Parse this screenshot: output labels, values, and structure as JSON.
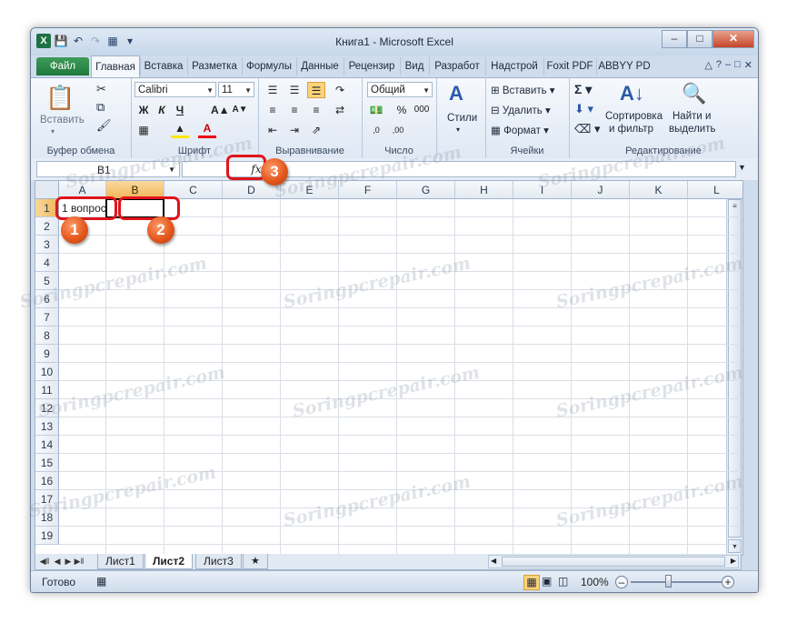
{
  "window": {
    "title": "Книга1 - Microsoft Excel"
  },
  "tabs": [
    "Файл",
    "Главная",
    "Вставка",
    "Разметка",
    "Формулы",
    "Данные",
    "Рецензир",
    "Вид",
    "Разработ",
    "Надстрой",
    "Foxit PDF",
    "ABBYY PD"
  ],
  "ribbon": {
    "clipboard": {
      "paste": "Вставить",
      "label": "Буфер обмена"
    },
    "font": {
      "name": "Calibri",
      "size": "11",
      "bold": "Ж",
      "italic": "К",
      "underline": "Ч",
      "label": "Шрифт"
    },
    "align": {
      "label": "Выравнивание"
    },
    "number": {
      "format": "Общий",
      "label": "Число"
    },
    "styles": {
      "label": "Стили"
    },
    "cells": {
      "insert": "Вставить",
      "delete": "Удалить",
      "format": "Формат",
      "label": "Ячейки"
    },
    "editing": {
      "sort1": "Сортировка",
      "sort2": "и фильтр",
      "find1": "Найти и",
      "find2": "выделить",
      "label": "Редактирование"
    }
  },
  "formula_bar": {
    "name_box": "B1",
    "fx": "fx",
    "value": ""
  },
  "grid": {
    "columns": [
      "A",
      "B",
      "C",
      "D",
      "E",
      "F",
      "G",
      "H",
      "I",
      "J",
      "K",
      "L"
    ],
    "rows": [
      "1",
      "2",
      "3",
      "4",
      "5",
      "6",
      "7",
      "8",
      "9",
      "10",
      "11",
      "12",
      "13",
      "14",
      "15",
      "16",
      "17",
      "18",
      "19"
    ],
    "cells": {
      "A1": "1 вопрос"
    }
  },
  "sheets": [
    "Лист1",
    "Лист2",
    "Лист3"
  ],
  "status": {
    "ready": "Готово",
    "zoom": "100%"
  },
  "annotations": [
    "1",
    "2",
    "3"
  ],
  "watermark": "Soringpcrepair.com",
  "colors": {
    "file_tab": "#1e7a3a",
    "selected_header": "#f1b65b",
    "marker": "#e0141a",
    "badge": "#e4581e"
  }
}
